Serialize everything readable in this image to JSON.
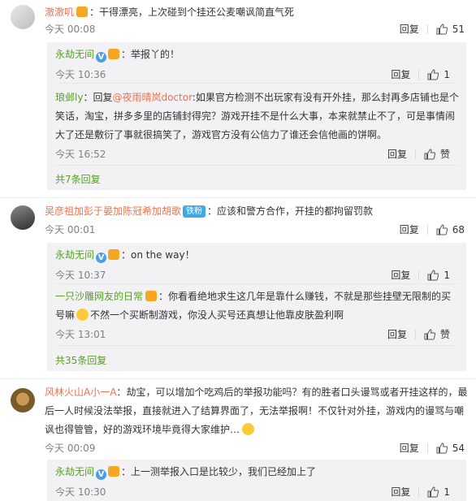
{
  "comments": [
    {
      "user": "澈澈叽",
      "text": "干得漂亮，上次碰到个挂还公麦嘲讽简直气死",
      "time": "今天 00:08",
      "reply_label": "回复",
      "likes": "51",
      "replies": [
        {
          "user": "永劫无间",
          "text": "举报丫的！",
          "time": "今天 10:36",
          "reply_label": "回复",
          "likes": "1"
        },
        {
          "user": "琅邺ly",
          "text_prefix": "回复",
          "mention": "@夜雨晴岚doctor",
          "text": ":如果官方检测不出玩家有没有开外挂，那么封再多店铺也是个笑话，淘宝，拼多多里的店铺封得完？游戏开挂不是什么大事，本来就禁止不了，可是事情闹大了还是敷衍了事就很搞笑了，游戏官方没有公信力了谁还会信他画的饼啊。",
          "lines": [
            "回复@夜雨晴岚doctor:如果官方检测不出玩家有没有开外挂，那么封再多店铺也是个",
            "笑话，淘宝，拼多多里的店铺封得完？游戏开挂不是什么大事，本来就禁止不了，可是事情闹",
            "大了还是敷衍了事就很搞笑了，游戏官方没有公信力了谁还会信他画的饼啊。"
          ],
          "time": "今天 16:52",
          "reply_label": "回复",
          "likes": "赞"
        }
      ],
      "more": "共7条回复"
    },
    {
      "user": "吴彦祖加彭于晏加陈冠希加胡歌",
      "badge": "铁粉",
      "text": "应该和警方合作，开挂的都拘留罚款",
      "time": "今天 00:01",
      "reply_label": "回复",
      "likes": "68",
      "replies": [
        {
          "user": "永劫无间",
          "text": "on the way！",
          "time": "今天 10:37",
          "reply_label": "回复",
          "likes": "1"
        },
        {
          "user": "一只沙雕网友的日常",
          "lines": [
            "你看看绝地求生这几年是靠什么赚钱，不就是那些挂壁无限制的买",
            "号嘛",
            "不然一个买断制游戏，你没人买号还真想让他靠皮肤盈利啊"
          ],
          "time": "今天 13:01",
          "reply_label": "回复",
          "likes": "赞"
        }
      ],
      "more": "共35条回复"
    },
    {
      "user": "风林火山A小一A",
      "lines": [
        "劫宝，可以增加个吃鸡后的举报功能吗？有的胜者口头谩骂或者开挂这样的，最",
        "后一人时候没法举报，直接就进入了结算界面了，无法举报啊！不仅针对外挂，游戏内的谩骂与嘲",
        "讽也得管管，好的游戏环境毕竟得大家维护…"
      ],
      "time": "今天 00:09",
      "reply_label": "回复",
      "likes": "54",
      "replies": [
        {
          "user": "永劫无间",
          "text": "上一测举报入口是比较少，我们已经加上了",
          "time": "今天 10:30",
          "reply_label": "回复",
          "likes": "1"
        }
      ]
    }
  ],
  "colors": {
    "accent_orange": "#eb7350",
    "reply_green": "#56a21e",
    "reply_bg": "#f2f2f5"
  }
}
